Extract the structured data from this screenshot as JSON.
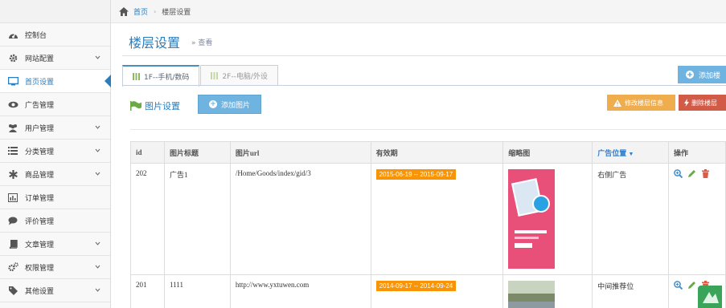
{
  "breadcrumb": {
    "home": "首页",
    "current": "楼层设置"
  },
  "sidebar": {
    "items": [
      {
        "label": "控制台",
        "icon": "dashboard-icon",
        "has_arrow": false
      },
      {
        "label": "网站配置",
        "icon": "gear-icon",
        "has_arrow": true
      },
      {
        "label": "首页设置",
        "icon": "desktop-icon",
        "has_arrow": false,
        "active": true
      },
      {
        "label": "广告管理",
        "icon": "eye-icon",
        "has_arrow": false
      },
      {
        "label": "用户管理",
        "icon": "users-icon",
        "has_arrow": true
      },
      {
        "label": "分类管理",
        "icon": "list-icon",
        "has_arrow": true
      },
      {
        "label": "商品管理",
        "icon": "asterisk-icon",
        "has_arrow": true
      },
      {
        "label": "订单管理",
        "icon": "bar-chart-icon",
        "has_arrow": false
      },
      {
        "label": "评价管理",
        "icon": "comment-icon",
        "has_arrow": false
      },
      {
        "label": "文章管理",
        "icon": "book-icon",
        "has_arrow": true
      },
      {
        "label": "权限管理",
        "icon": "cogs-icon",
        "has_arrow": true
      },
      {
        "label": "其他设置",
        "icon": "tag-icon",
        "has_arrow": true
      }
    ]
  },
  "page": {
    "title": "楼层设置",
    "subtitle": "» 查看"
  },
  "tabs": [
    {
      "label": "1F--手机/数码",
      "active": true
    },
    {
      "label": "2F--电脑/外设",
      "active": false
    }
  ],
  "toolbar": {
    "add_floor_label": "添加楼",
    "section_title": "图片设置",
    "add_image_label": "添加图片",
    "edit_floor_label": "修改楼层信息",
    "delete_floor_label": "删除楼层"
  },
  "table": {
    "headers": [
      "id",
      "图片标题",
      "图片url",
      "有效期",
      "缩略图",
      "广告位置",
      "操作"
    ],
    "rows": [
      {
        "id": "202",
        "title": "广告1",
        "url": "/Home/Goods/index/gid/3",
        "period": "2015-06-19 -- 2015-09-17",
        "position": "右侧广告"
      },
      {
        "id": "201",
        "title": "1111",
        "url": "http://www.yxtuwen.com",
        "period": "2014-09-17 -- 2014-09-24",
        "position": "中间推荐位"
      }
    ]
  },
  "colors": {
    "accent": "#2b7dbc",
    "button_blue": "#6fb3e0",
    "warning": "#f0ad4e",
    "danger": "#d15b47",
    "date_badge": "#f89406"
  }
}
